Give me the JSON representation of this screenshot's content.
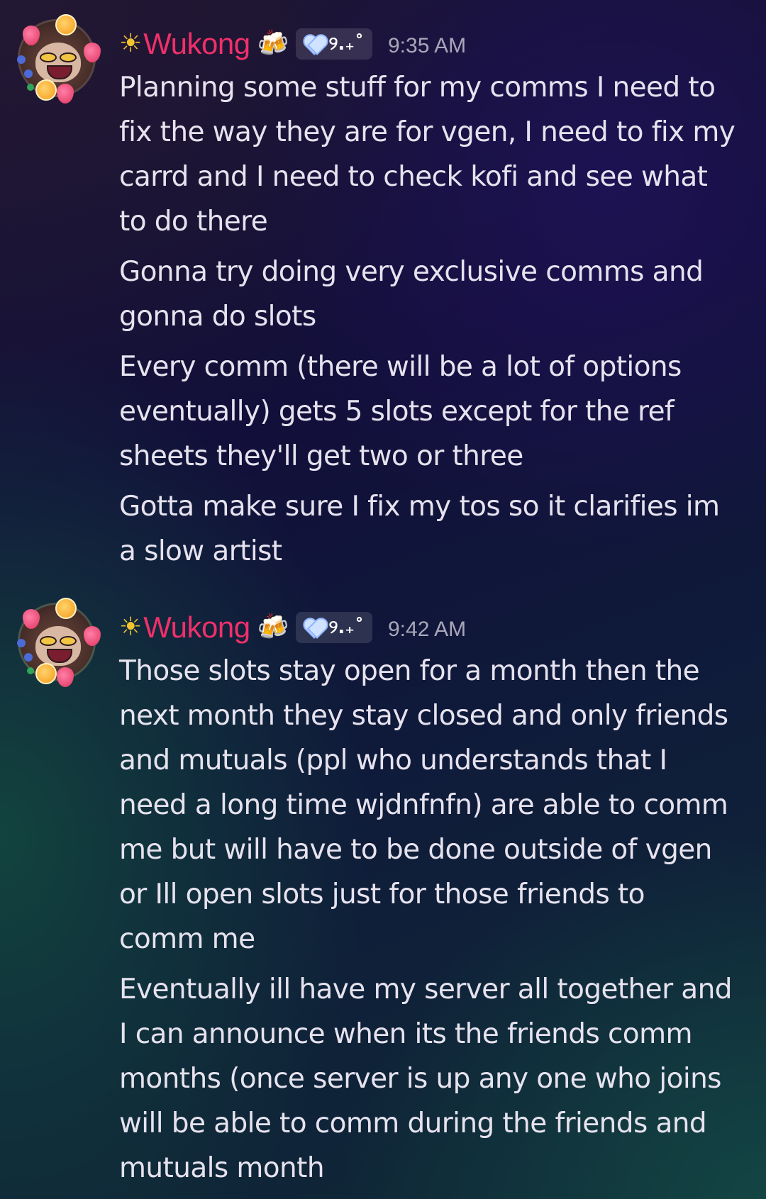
{
  "messages": [
    {
      "author": "Wukong",
      "tag": "୨.₊˚",
      "time": "9:35 AM",
      "paragraphs": [
        [
          "Planning some stuff for my comms I need to",
          "fix the way they are for vgen, I need to fix my",
          "carrd and I need to check kofi and see what",
          "to do there"
        ],
        [
          "Gonna try doing very exclusive comms and",
          "gonna do slots"
        ],
        [
          "Every comm (there will be a lot of options",
          "eventually) gets 5 slots except for the ref",
          "sheets they'll get two or three"
        ],
        [
          "Gotta make sure I fix my tos so it clarifies im",
          "a slow artist"
        ]
      ]
    },
    {
      "author": "Wukong",
      "tag": "୨.₊˚",
      "time": "9:42 AM",
      "paragraphs": [
        [
          "Those slots stay open for a month then the",
          "next month they stay closed and only friends",
          "and mutuals (ppl who understands that I",
          "need a long time wjdnfnfn) are able to comm",
          "me but will have to be done outside of vgen",
          "or Ill open slots just for those friends to",
          "comm me"
        ],
        [
          "Eventually ill have my server all together and",
          "I can announce when its the friends comm",
          "months (once server is up any one who joins",
          "will be able to comm during the friends and",
          "mutuals month"
        ]
      ]
    }
  ],
  "icons": {
    "name_prefix": "sun-icon",
    "name_suffix": "beer-mugs-icon",
    "badge": "heart-icon"
  },
  "colors": {
    "username": "#f0306a",
    "timestamp": "#a8a6b8",
    "text": "#e6e2ee"
  }
}
